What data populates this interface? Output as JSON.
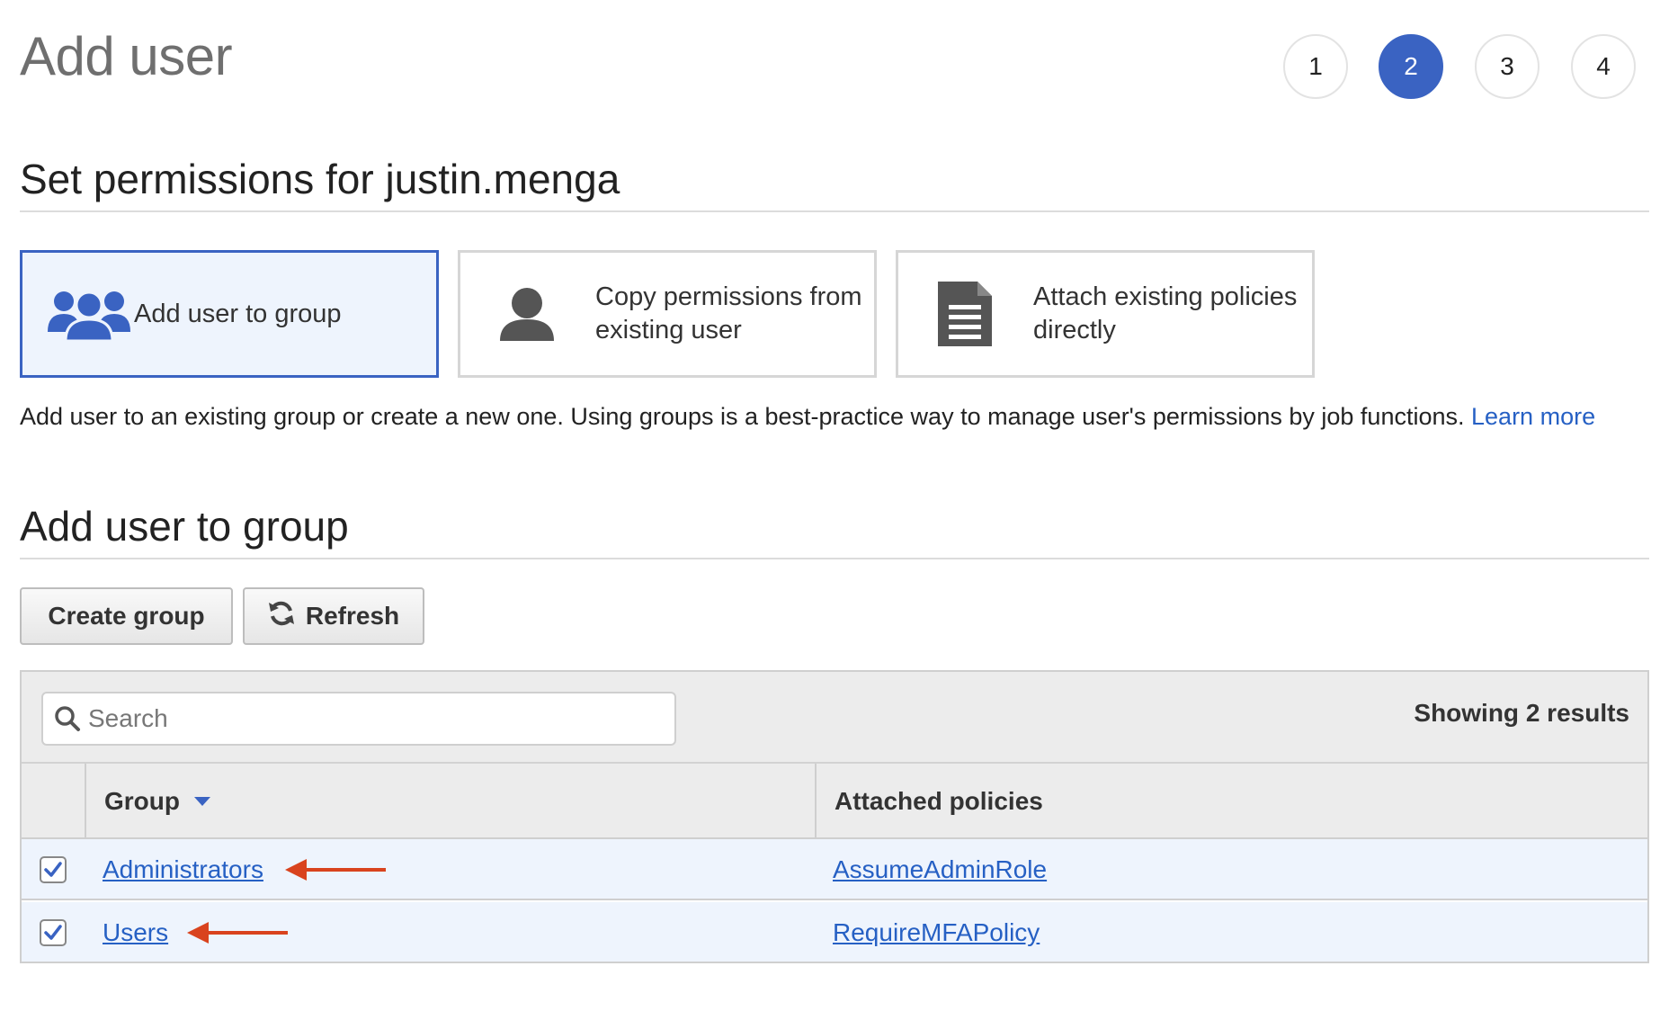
{
  "page": {
    "title": "Add user"
  },
  "steps": [
    {
      "label": "1",
      "active": false
    },
    {
      "label": "2",
      "active": true
    },
    {
      "label": "3",
      "active": false
    },
    {
      "label": "4",
      "active": false
    }
  ],
  "permissions": {
    "title": "Set permissions for justin.menga",
    "options": [
      {
        "label": "Add user to group",
        "icon": "group-icon",
        "selected": true
      },
      {
        "label": "Copy permissions from existing user",
        "icon": "user-icon",
        "selected": false
      },
      {
        "label": "Attach existing policies directly",
        "icon": "document-icon",
        "selected": false
      }
    ],
    "description": "Add user to an existing group or create a new one. Using groups is a best-practice way to manage user's permissions by job functions.",
    "learn_more": "Learn more"
  },
  "group_section": {
    "title": "Add user to group",
    "create_button": "Create group",
    "refresh_button": "Refresh",
    "search_placeholder": "Search",
    "results_text": "Showing 2 results",
    "columns": {
      "group": "Group",
      "policies": "Attached policies"
    },
    "rows": [
      {
        "group": "Administrators",
        "policy": "AssumeAdminRole",
        "checked": true
      },
      {
        "group": "Users",
        "policy": "RequireMFAPolicy",
        "checked": true
      }
    ]
  },
  "colors": {
    "accent": "#3a63c2",
    "link": "#2660c4",
    "selected_bg": "#eef4fd",
    "annotation_arrow": "#d9431e"
  }
}
